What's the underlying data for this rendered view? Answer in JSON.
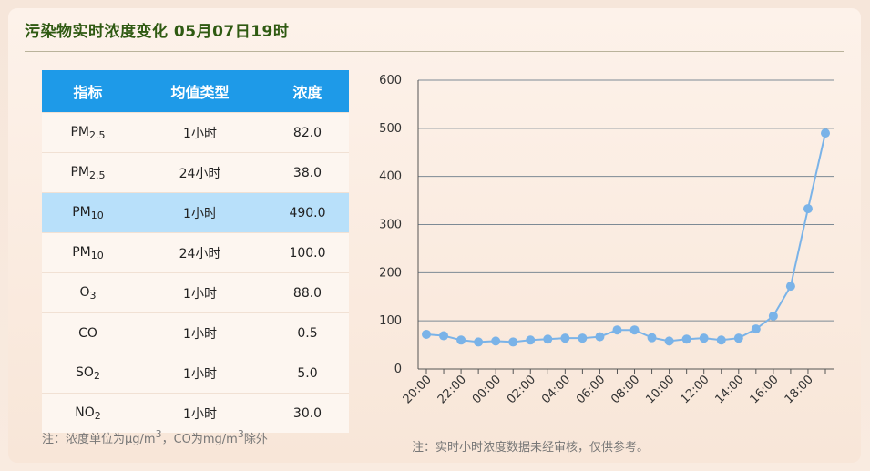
{
  "header": {
    "title": "污染物实时浓度变化 05月07日19时"
  },
  "table": {
    "columns": [
      "指标",
      "均值类型",
      "浓度"
    ],
    "rows": [
      {
        "base": "PM",
        "sub": "2.5",
        "avg": "1小时",
        "value": "82.0",
        "highlight": false
      },
      {
        "base": "PM",
        "sub": "2.5",
        "avg": "24小时",
        "value": "38.0",
        "highlight": false
      },
      {
        "base": "PM",
        "sub": "10",
        "avg": "1小时",
        "value": "490.0",
        "highlight": true
      },
      {
        "base": "PM",
        "sub": "10",
        "avg": "24小时",
        "value": "100.0",
        "highlight": false
      },
      {
        "base": "O",
        "sub": "3",
        "avg": "1小时",
        "value": "88.0",
        "highlight": false
      },
      {
        "base": "CO",
        "sub": "",
        "avg": "1小时",
        "value": "0.5",
        "highlight": false
      },
      {
        "base": "SO",
        "sub": "2",
        "avg": "1小时",
        "value": "5.0",
        "highlight": false
      },
      {
        "base": "NO",
        "sub": "2",
        "avg": "1小时",
        "value": "30.0",
        "highlight": false
      }
    ],
    "header_color": "#1e9ae8",
    "highlight_color": "#b8e0fa"
  },
  "notes": {
    "left_prefix": "注：浓度单位为μg/m",
    "left_sup1": "3",
    "left_mid": "，CO为mg/m",
    "left_sup2": "3",
    "left_suffix": "除外",
    "right": "注：实时小时浓度数据未经审核，仅供参考。"
  },
  "chart_data": {
    "type": "line",
    "title": "",
    "xlabel": "",
    "ylabel": "",
    "ylim": [
      0,
      600
    ],
    "yticks": [
      0,
      100,
      200,
      300,
      400,
      500,
      600
    ],
    "x": [
      "20:00",
      "21:00",
      "22:00",
      "23:00",
      "00:00",
      "01:00",
      "02:00",
      "03:00",
      "04:00",
      "05:00",
      "06:00",
      "07:00",
      "08:00",
      "09:00",
      "10:00",
      "11:00",
      "12:00",
      "13:00",
      "14:00",
      "15:00",
      "16:00",
      "17:00",
      "18:00",
      "19:00"
    ],
    "xtick_labels": [
      "20:00",
      "22:00",
      "00:00",
      "02:00",
      "04:00",
      "06:00",
      "08:00",
      "10:00",
      "12:00",
      "14:00",
      "16:00",
      "18:00"
    ],
    "series": [
      {
        "values": [
          72,
          69,
          60,
          56,
          58,
          56,
          60,
          62,
          64,
          64,
          67,
          81,
          81,
          65,
          58,
          62,
          64,
          60,
          64,
          83,
          110,
          172,
          333,
          490
        ]
      }
    ],
    "grid": true,
    "color": "#7ab3e8"
  }
}
